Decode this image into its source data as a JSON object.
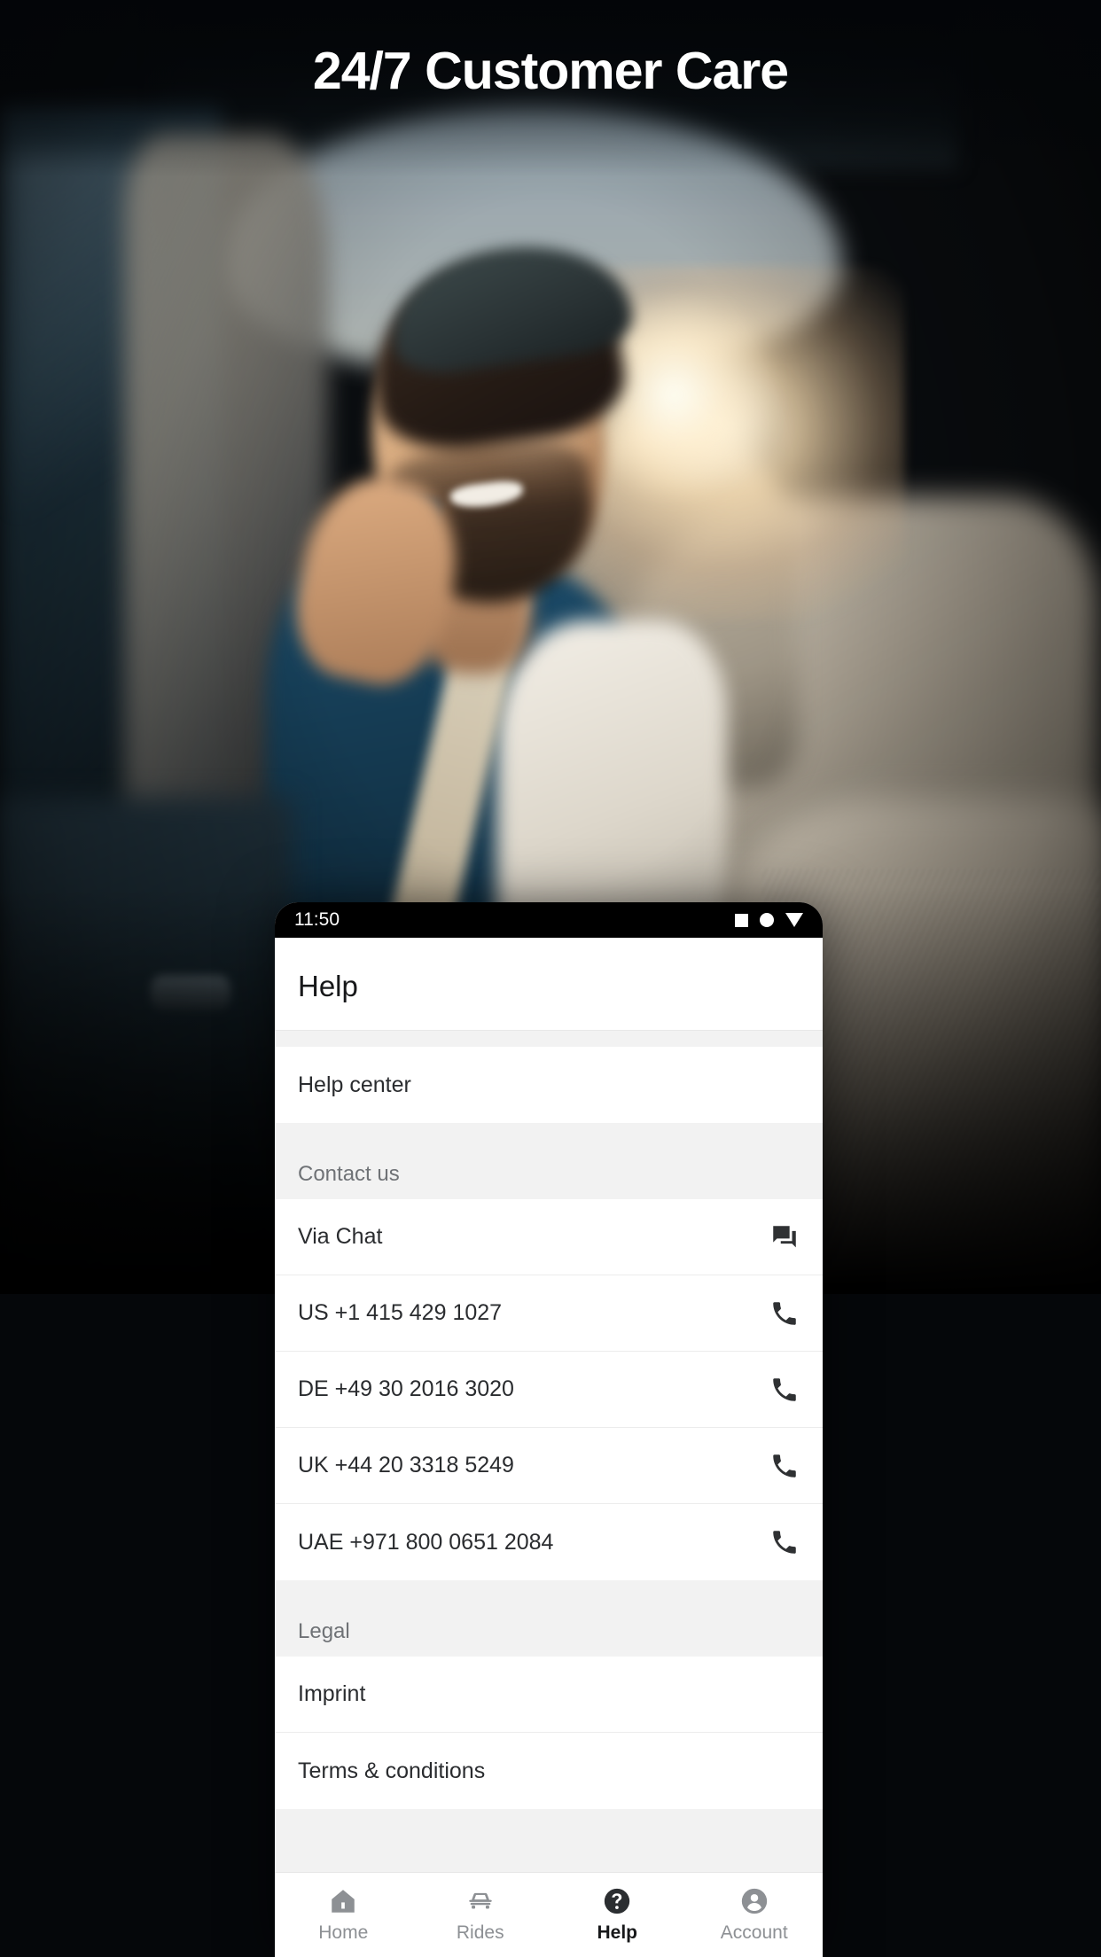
{
  "hero": {
    "headline": "24/7 Customer Care"
  },
  "status_bar": {
    "time": "11:50",
    "icons": [
      "square-icon",
      "circle-icon",
      "triangle-down-icon"
    ]
  },
  "app": {
    "page_title": "Help",
    "top_items": [
      {
        "label": "Help center",
        "icon": null
      }
    ],
    "sections": [
      {
        "heading": "Contact us",
        "items": [
          {
            "label": "Via Chat",
            "icon": "chat-icon"
          },
          {
            "label": "US +1 415 429 1027",
            "icon": "phone-icon"
          },
          {
            "label": "DE +49 30 2016 3020",
            "icon": "phone-icon"
          },
          {
            "label": "UK +44 20 3318 5249",
            "icon": "phone-icon"
          },
          {
            "label": "UAE +971 800 0651 2084",
            "icon": "phone-icon"
          }
        ]
      },
      {
        "heading": "Legal",
        "items": [
          {
            "label": "Imprint",
            "icon": null
          },
          {
            "label": "Terms & conditions",
            "icon": null
          }
        ]
      }
    ],
    "bottom_nav": [
      {
        "label": "Home",
        "icon": "home-icon",
        "active": false
      },
      {
        "label": "Rides",
        "icon": "car-icon",
        "active": false
      },
      {
        "label": "Help",
        "icon": "help-question-icon",
        "active": true
      },
      {
        "label": "Account",
        "icon": "account-person-icon",
        "active": false
      }
    ]
  },
  "colors": {
    "active": "#2b2e31",
    "inactive": "#8d9094",
    "text": "#2a2c2f",
    "muted": "#6f7276",
    "background": "#f2f2f2",
    "card": "#ffffff"
  }
}
